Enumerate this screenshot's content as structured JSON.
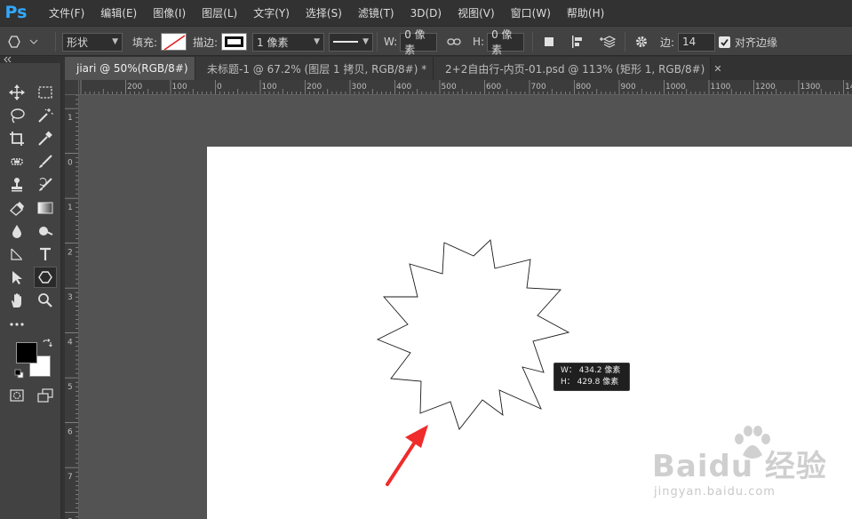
{
  "app": {
    "logo": "Ps"
  },
  "menu": [
    "文件(F)",
    "编辑(E)",
    "图像(I)",
    "图层(L)",
    "文字(Y)",
    "选择(S)",
    "滤镜(T)",
    "3D(D)",
    "视图(V)",
    "窗口(W)",
    "帮助(H)"
  ],
  "options": {
    "tool_mode": "形状",
    "fill_label": "填充:",
    "stroke_label": "描边:",
    "stroke_width": "1 像素",
    "w_label": "W:",
    "w_value": "0 像素",
    "h_label": "H:",
    "h_value": "0 像素",
    "sides_label": "边:",
    "sides_value": "14",
    "align_edges_label": "对齐边缘",
    "align_edges_checked": true
  },
  "tabs": [
    {
      "label": "jiari @ 50%(RGB/8#)",
      "active": true
    },
    {
      "label": "未标题-1 @ 67.2% (图层 1 拷贝, RGB/8#) *",
      "active": false
    },
    {
      "label": "2+2自由行-内页-01.psd @ 113% (矩形 1, RGB/8#)",
      "active": false
    }
  ],
  "ruler_h": [
    "200",
    "100",
    "0",
    "100",
    "200",
    "300",
    "400",
    "500",
    "600",
    "700",
    "800",
    "900",
    "1000",
    "1100",
    "1200",
    "1300",
    "1400"
  ],
  "ruler_v": [
    "1",
    "0",
    "1",
    "2",
    "3",
    "4",
    "5",
    "6",
    "7",
    "8"
  ],
  "tooltip": {
    "w_line": "W： 434.2 像素",
    "h_line": "H： 429.8 像素"
  },
  "watermark": {
    "brand": "Baidu 经验",
    "sub": "jingyan.baidu.com"
  },
  "colors": {
    "accent": "#31a8ff",
    "annotation_arrow": "#ef2b2b",
    "foreground": "#000000",
    "background": "#ffffff"
  }
}
